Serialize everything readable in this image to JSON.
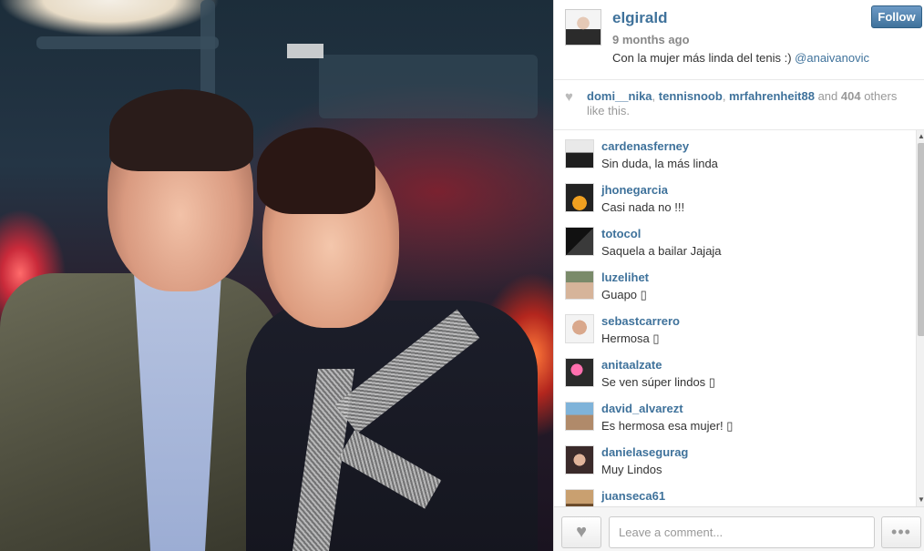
{
  "post": {
    "owner": "elgirald",
    "time": "9 months ago",
    "caption_text": "Con la mujer más linda del tenis :)",
    "caption_mention": "@anaivanovic",
    "follow_label": "Follow"
  },
  "likes": {
    "users": [
      "domi__nika",
      "tennisnoob",
      "mrfahrenheit88"
    ],
    "sep1": ", ",
    "sep2": ", ",
    "and": " and ",
    "count": "404",
    "suffix": " others like this."
  },
  "comments": [
    {
      "user": "cardenasferney",
      "text": "Sin duda, la más linda"
    },
    {
      "user": "jhonegarcia",
      "text": "Casi nada no !!!"
    },
    {
      "user": "totocol",
      "text": "Saquela a bailar Jajaja"
    },
    {
      "user": "luzelihet",
      "text": "Guapo ▯"
    },
    {
      "user": "sebastcarrero",
      "text": "Hermosa ▯"
    },
    {
      "user": "anitaalzate",
      "text": "Se ven súper lindos ▯"
    },
    {
      "user": "david_alvarezt",
      "text": "Es hermosa esa mujer! ▯"
    },
    {
      "user": "danielasegurag",
      "text": "Muy Lindos"
    },
    {
      "user": "juanseca61",
      "text": ""
    }
  ],
  "footer": {
    "comment_placeholder": "Leave a comment...",
    "like_icon": "♥",
    "more_icon": "•••"
  },
  "colors": {
    "link": "#3f729b",
    "follow_bg": "#3f729b"
  }
}
